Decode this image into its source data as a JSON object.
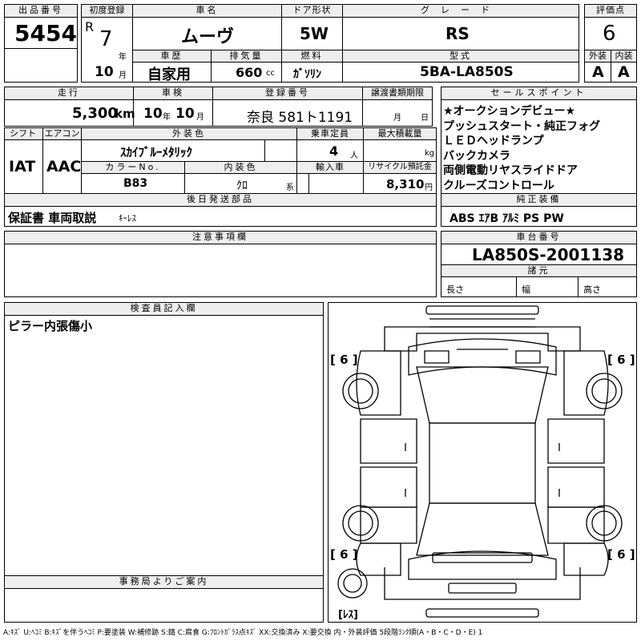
{
  "header": {
    "lot_label": "出品番号",
    "lot_no": "5454",
    "first_reg_label": "初度登録",
    "era": "R",
    "year": "7",
    "year_unit": "年",
    "month": "10",
    "month_unit": "月",
    "name_label": "車名",
    "name": "ムーヴ",
    "door_label": "ドア形状",
    "door": "5W",
    "grade_label": "グレード",
    "grade": "RS",
    "score_label": "評価点",
    "score": "6",
    "history_label": "車歴",
    "history": "自家用",
    "displacement_label": "排気量",
    "displacement": "660",
    "displacement_unit": "cc",
    "fuel_label": "燃料",
    "fuel": "ｶﾞｿﾘﾝ",
    "model_label": "型式",
    "model": "5BA-LA850S",
    "exterior_label": "外装",
    "exterior": "A",
    "interior_label": "内装",
    "interior": "A"
  },
  "row2": {
    "mileage_label": "走行",
    "mileage": "5,300",
    "mileage_unit": "km",
    "inspection_label": "車検",
    "insp_year": "10",
    "insp_year_unit": "年",
    "insp_month": "10",
    "insp_month_unit": "月",
    "plate_label": "登録番号",
    "plate": "奈良 581ト1191",
    "transfer_label": "譲渡書類期限",
    "transfer_month_unit": "月",
    "transfer_day_unit": "日"
  },
  "row3": {
    "shift_label": "シフト",
    "shift": "IAT",
    "ac_label": "エアコン",
    "ac": "AAC",
    "color_label": "外装色",
    "color": "ｽｶｲﾌﾞﾙｰﾒﾀﾘｯｸ",
    "capacity_label": "乗車定員",
    "capacity": "4",
    "capacity_unit": "人",
    "load_label": "最大積載量",
    "load_unit": "kg",
    "color_no_label": "カラーNo.",
    "color_no": "B83",
    "interior_color_label": "内装色",
    "interior_color": "ｸﾛ",
    "interior_color_unit": "系",
    "import_label": "輸入車",
    "recycle_label": "リサイクル預託金",
    "recycle": "8,310",
    "recycle_unit": "円"
  },
  "sales_points": {
    "label": "セールスポイント",
    "items": [
      "★オークションデビュー★",
      "プッシュスタート・純正フォグ",
      "ＬＥＤヘッドランプ",
      "バックカメラ",
      "両側電動リヤスライドドア",
      "クルーズコントロール"
    ]
  },
  "later_parts": {
    "label": "後日発送部品",
    "value": "保証書 車両取説",
    "extra": "ｷｰﾚｽ"
  },
  "genuine": {
    "label": "純正装備",
    "value": "ABS ｴｱB ｱﾙﾐ PS PW"
  },
  "notes": {
    "label": "注意事項欄"
  },
  "chassis": {
    "label": "車台番号",
    "value": "LA850S-2001138",
    "dims_label": "諸元",
    "length_label": "長さ",
    "width_label": "幅",
    "height_label": "高さ"
  },
  "inspector": {
    "label": "検査員記入欄",
    "text": "ピラー内張傷小"
  },
  "office": {
    "label": "事務局よりご案内"
  },
  "diagram": {
    "tire_fl": "[ 6 ]",
    "tire_fr": "[ 6 ]",
    "tire_rl": "[ 6 ]",
    "tire_rr": "[ 6 ]",
    "spare": "[ﾚｽ]"
  },
  "legend": "A:ｷｽﾞ U:ﾍｺﾐ B:ｷｽﾞを伴うﾍｺﾐ P:要塗装 W:補修跡 S:錆 C:腐食 G:ﾌﾛﾝﾄｶﾞﾗｽ点ｷｽﾞ XX:交換済み X:要交換 内・外装評価 5段階ﾗﾝｸ順(A・B・C・D・E) 1"
}
